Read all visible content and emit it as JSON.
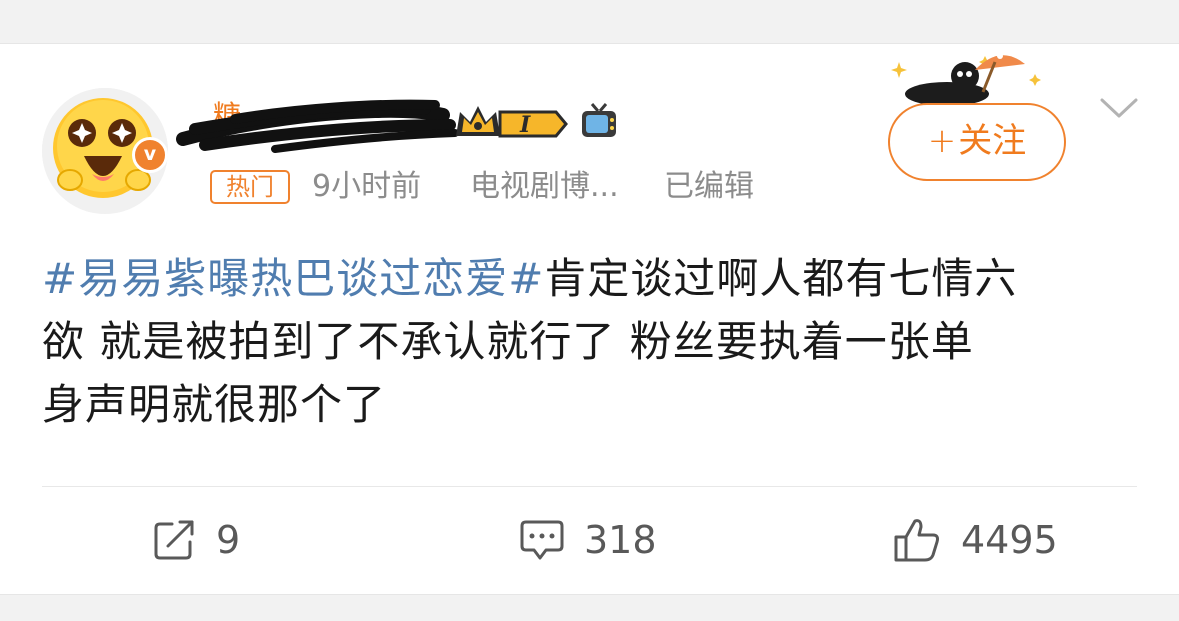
{
  "post": {
    "hot_label": "热门",
    "time": "9小时前",
    "source": "电视剧博...",
    "edited": "已编辑",
    "follow_label": "关注",
    "follow_plus": "+",
    "verified_mark": "v",
    "hashtag": "#易易紫曝热巴谈过恋爱#",
    "body_line1": "肯定谈过啊人都有七情六",
    "body_line2": "欲 就是被拍到了不承认就行了 粉丝要执着一张单",
    "body_line3": "身声明就很那个了"
  },
  "actions": {
    "repost_count": "9",
    "comment_count": "318",
    "like_count": "4495"
  },
  "colors": {
    "accent": "#f0822e",
    "hashtag": "#507daf",
    "meta": "#8c8c8c"
  },
  "icons": [
    "repost-icon",
    "comment-icon",
    "like-icon",
    "tv-icon",
    "crown-badge-icon",
    "chevron-down-icon"
  ]
}
